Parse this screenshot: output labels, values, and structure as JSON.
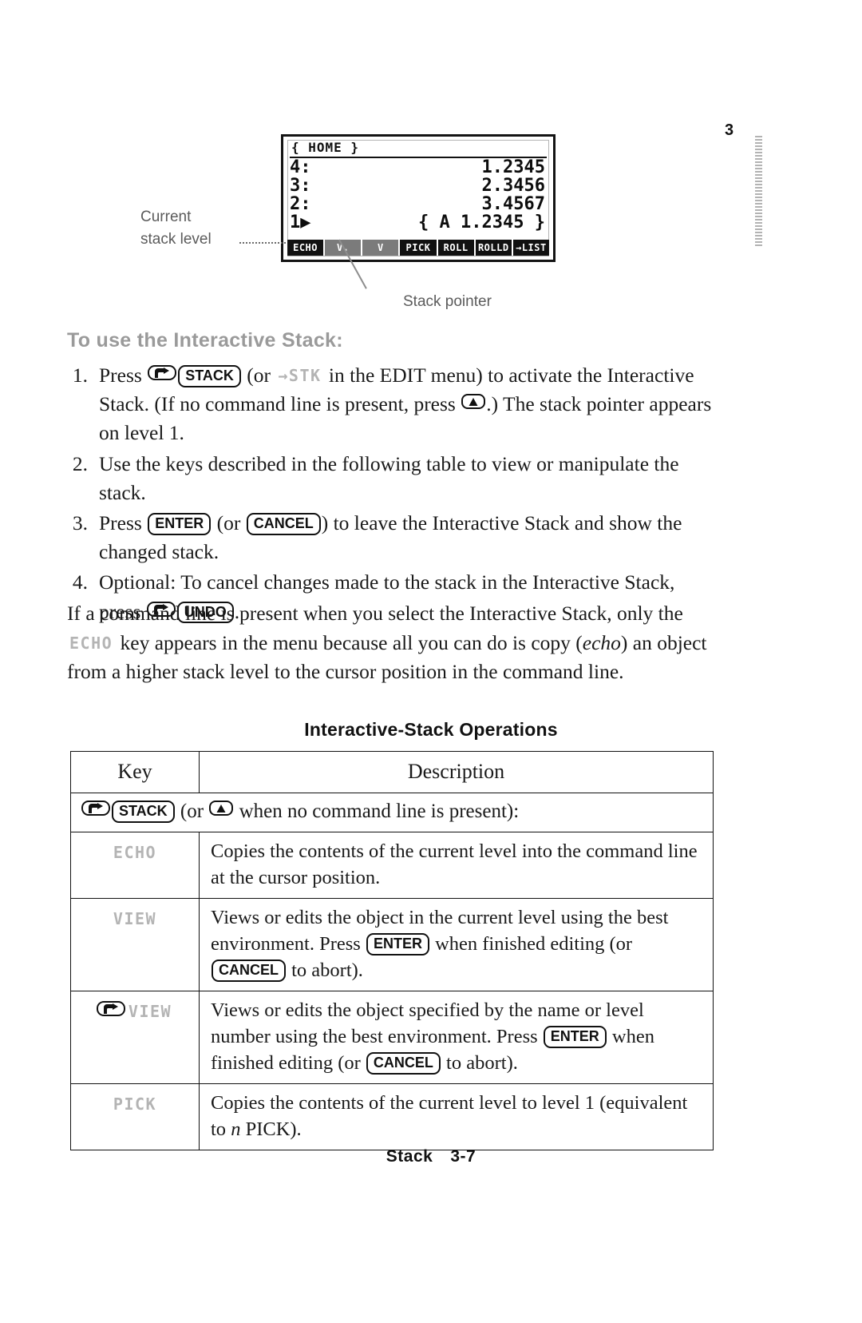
{
  "page": {
    "thumb_index": "3",
    "footer_section": "Stack",
    "footer_page": "3-7"
  },
  "figure": {
    "callout_current_line1": "Current",
    "callout_current_line2": "stack level",
    "callout_pointer": "Stack pointer",
    "screen": {
      "header": "{ HOME }",
      "rows": [
        {
          "level": "4:",
          "value": "1.2345"
        },
        {
          "level": "3:",
          "value": "2.3456"
        },
        {
          "level": "2:",
          "value": "3.4567"
        },
        {
          "level": "1",
          "pointer": "▶",
          "value": "{ A 1.2345 }"
        }
      ],
      "menu_keys": [
        "ECHO",
        "V.",
        "V",
        "PICK",
        "ROLL",
        "ROLLD",
        "→LIST"
      ]
    }
  },
  "section": {
    "heading": "To use the Interactive Stack:"
  },
  "steps": [
    {
      "num": "1.",
      "parts": [
        {
          "t": "text",
          "v": "Press "
        },
        {
          "t": "shiftkey",
          "v": "right-shift"
        },
        {
          "t": "keycap",
          "v": "STACK"
        },
        {
          "t": "text",
          "v": " (or "
        },
        {
          "t": "screenfont",
          "v": "→STK"
        },
        {
          "t": "text",
          "v": " in the EDIT menu) to activate the Interactive Stack. (If no command line is present, press "
        },
        {
          "t": "updirkey",
          "v": "up-arrow"
        },
        {
          "t": "text",
          "v": ".) The stack pointer appears on level 1."
        }
      ]
    },
    {
      "num": "2.",
      "parts": [
        {
          "t": "text",
          "v": "Use the keys described in the following table to view or manipulate the stack."
        }
      ]
    },
    {
      "num": "3.",
      "parts": [
        {
          "t": "text",
          "v": "Press "
        },
        {
          "t": "keycap",
          "v": "ENTER"
        },
        {
          "t": "text",
          "v": " (or "
        },
        {
          "t": "keycap",
          "v": "CANCEL"
        },
        {
          "t": "text",
          "v": ") to leave the Interactive Stack and show the changed stack."
        }
      ]
    },
    {
      "num": "4.",
      "parts": [
        {
          "t": "text",
          "v": "Optional: To cancel changes made to the stack in the Interactive Stack, press "
        },
        {
          "t": "shiftkey",
          "v": "right-shift"
        },
        {
          "t": "keycap",
          "v": "UNDO"
        },
        {
          "t": "text",
          "v": "."
        }
      ]
    }
  ],
  "paragraph_commandline": {
    "parts": [
      {
        "t": "text",
        "v": "If a command line is present when you select the Interactive Stack, only the "
      },
      {
        "t": "screenfont",
        "v": "ECHO"
      },
      {
        "t": "text",
        "v": " key appears in the menu because all you can do is copy ("
      },
      {
        "t": "italic",
        "v": "echo"
      },
      {
        "t": "text",
        "v": ") an object from a higher stack level to the cursor position in the command line."
      }
    ]
  },
  "table": {
    "caption": "Interactive-Stack Operations",
    "headers": {
      "key": "Key",
      "description": "Description"
    },
    "span_row": {
      "parts": [
        {
          "t": "shiftkey",
          "v": "right-shift"
        },
        {
          "t": "keycap",
          "v": "STACK"
        },
        {
          "t": "text",
          "v": " (or "
        },
        {
          "t": "updirkey",
          "v": "up-arrow"
        },
        {
          "t": "text",
          "v": " when no command line is present):"
        }
      ]
    },
    "rows": [
      {
        "key_parts": [
          {
            "t": "screenfont",
            "v": "ECHO"
          }
        ],
        "desc_parts": [
          {
            "t": "text",
            "v": "Copies the contents of the current level into the command line at the cursor position."
          }
        ]
      },
      {
        "key_parts": [
          {
            "t": "screenfont",
            "v": "VIEW"
          }
        ],
        "desc_parts": [
          {
            "t": "text",
            "v": "Views or edits the object in the current level using the best environment. Press "
          },
          {
            "t": "keycap",
            "v": "ENTER"
          },
          {
            "t": "text",
            "v": " when finished editing (or "
          },
          {
            "t": "keycap",
            "v": "CANCEL"
          },
          {
            "t": "text",
            "v": " to abort)."
          }
        ]
      },
      {
        "key_parts": [
          {
            "t": "shiftkey",
            "v": "right-shift"
          },
          {
            "t": "screenfont",
            "v": "VIEW"
          }
        ],
        "desc_parts": [
          {
            "t": "text",
            "v": "Views or edits the object specified by the name or level number using the best environment. Press "
          },
          {
            "t": "keycap",
            "v": "ENTER"
          },
          {
            "t": "text",
            "v": " when finished editing (or "
          },
          {
            "t": "keycap",
            "v": "CANCEL"
          },
          {
            "t": "text",
            "v": " to abort)."
          }
        ]
      },
      {
        "key_parts": [
          {
            "t": "screenfont",
            "v": "PICK"
          }
        ],
        "desc_parts": [
          {
            "t": "text",
            "v": "Copies the contents of the current level to level 1 (equivalent to "
          },
          {
            "t": "italic",
            "v": "n"
          },
          {
            "t": "text",
            "v": " PICK)."
          }
        ]
      }
    ]
  }
}
